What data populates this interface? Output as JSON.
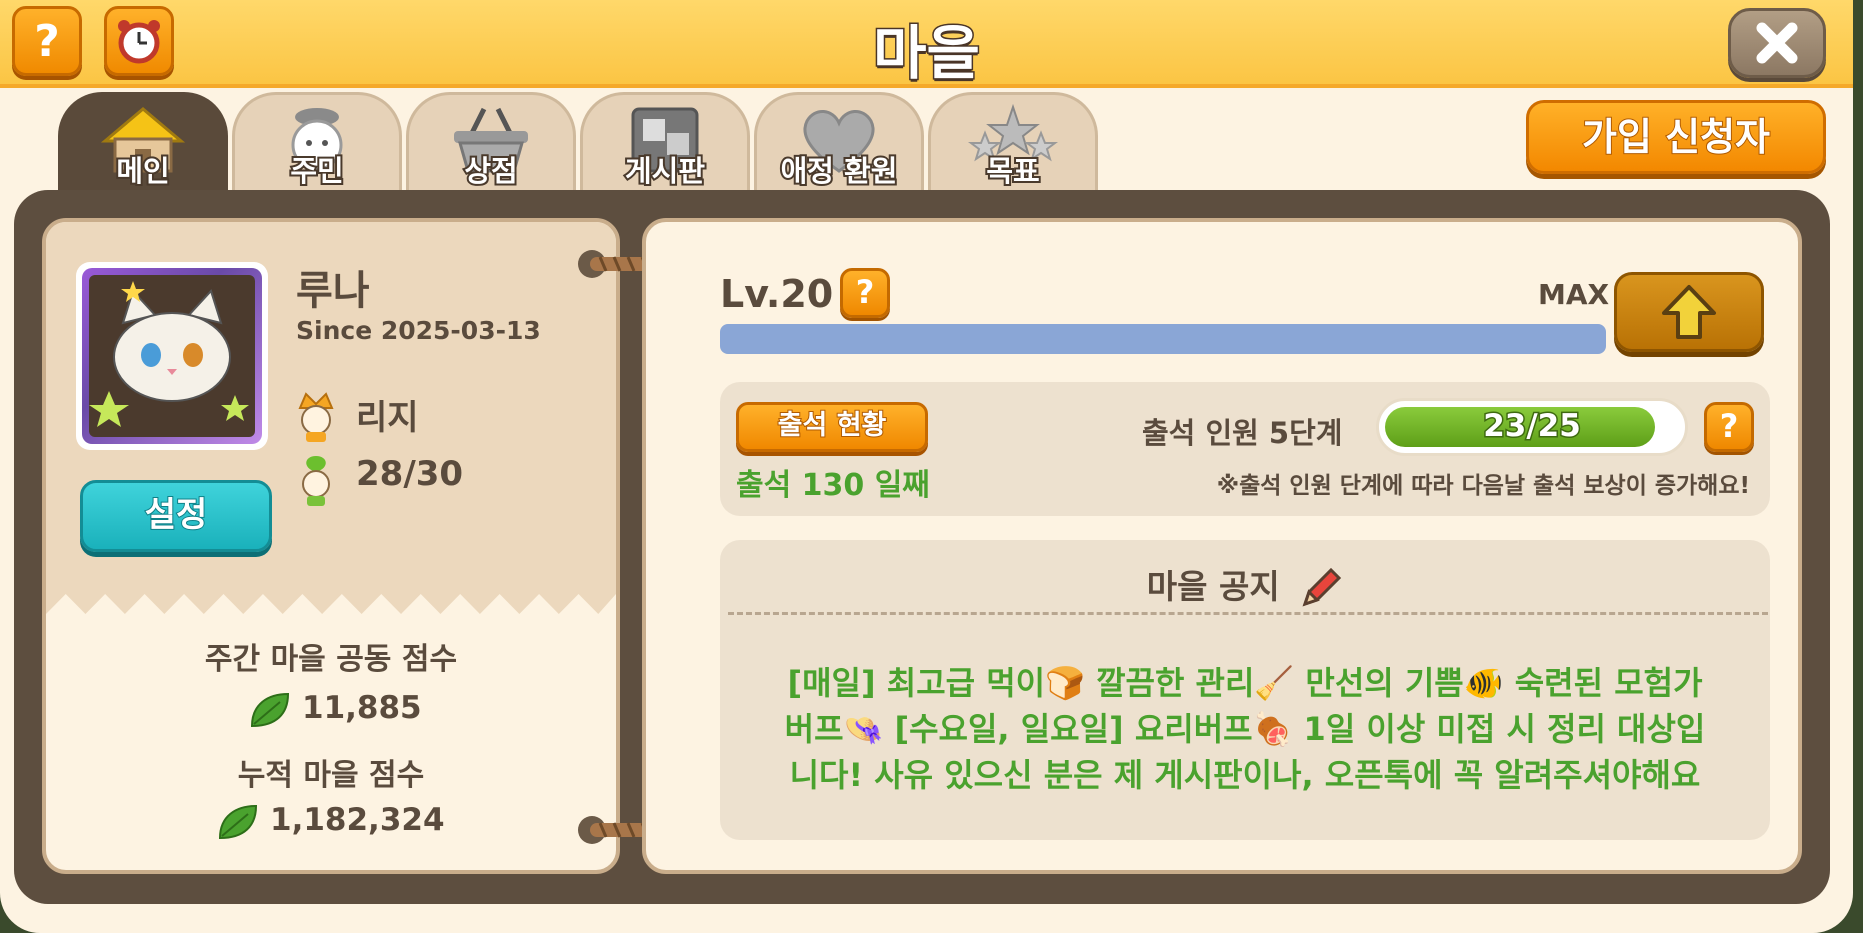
{
  "header": {
    "title": "마을",
    "help_label": "?",
    "alarm_icon": "alarm-clock-icon",
    "close_icon": "close-x-icon"
  },
  "tabs": [
    {
      "label": "메인",
      "icon": "house-icon",
      "active": true
    },
    {
      "label": "주민",
      "icon": "villager-icon",
      "active": false
    },
    {
      "label": "상점",
      "icon": "basket-icon",
      "active": false
    },
    {
      "label": "게시판",
      "icon": "board-icon",
      "active": false
    },
    {
      "label": "애정 환원",
      "icon": "heart-icon",
      "active": false
    },
    {
      "label": "목표",
      "icon": "stars-icon",
      "active": false
    }
  ],
  "apply_button": "가입 신청자",
  "profile": {
    "name": "루나",
    "since": "Since 2025-03-13",
    "leader": "리지",
    "members": "28/30",
    "settings_label": "설정"
  },
  "scores": {
    "weekly_label": "주간 마을 공동 점수",
    "weekly_value": "11,885",
    "total_label": "누적 마을 점수",
    "total_value": "1,182,324"
  },
  "level": {
    "label": "Lv.20",
    "help": "?",
    "max_label": "MAX",
    "progress": 1.0,
    "bar_color": "#8aa6d6"
  },
  "attendance": {
    "button": "출석 현황",
    "days": "출석 130 일째",
    "tier_label": "출석 인원 5단계",
    "tier_progress": "23/25",
    "tier_current": 23,
    "tier_max": 25,
    "help": "?",
    "note": "※출석 인원 단계에 따라 다음날 출석 보상이 증가해요!"
  },
  "notice": {
    "title": "마을 공지",
    "lines": [
      "[매일] 최고급 먹이🍞 깔끔한 관리🧹 만선의 기쁨🐠 숙련된 모험가",
      "버프👒 [수요일, 일요일] 요리버프🍖 1일 이상 미접 시 정리 대상입",
      "니다! 사유 있으신 분은 제 게시판이나, 오픈톡에 꼭 알려주셔야해요"
    ]
  },
  "colors": {
    "header": "#fbc544",
    "orange_button": "#f38800",
    "teal_button": "#1ab1bb",
    "board": "#5d4e3f",
    "notice_text": "#4aa22e"
  }
}
